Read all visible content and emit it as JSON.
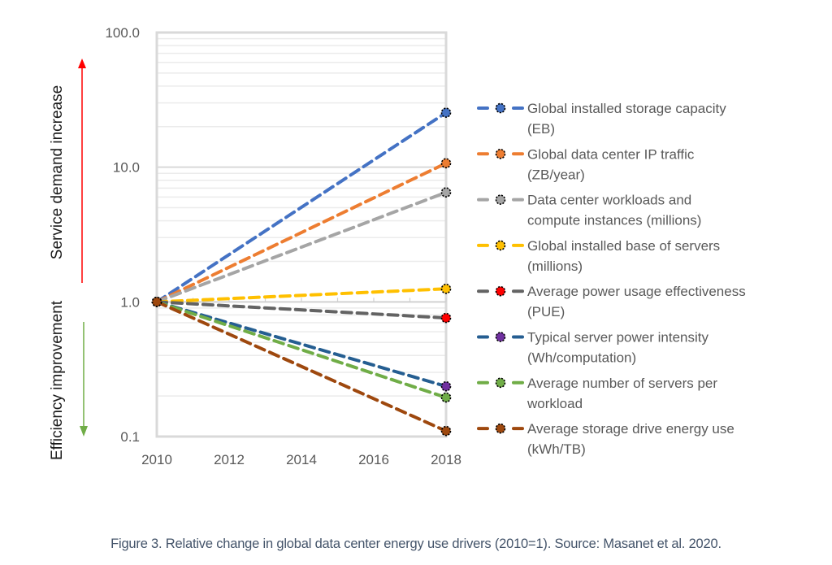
{
  "chart_data": {
    "type": "line",
    "title": "",
    "xlabel": "",
    "ylabel": "",
    "y_scale": "log",
    "ylim": [
      0.1,
      100
    ],
    "y_ticks": [
      "0.1",
      "1.0",
      "10.0",
      "100.0"
    ],
    "y_tick_values": [
      0.1,
      1,
      10,
      100
    ],
    "x_ticks": [
      "2010",
      "2012",
      "2014",
      "2016",
      "2018"
    ],
    "x_tick_values": [
      2010,
      2012,
      2014,
      2016,
      2018
    ],
    "xlim": [
      2010,
      2018
    ],
    "grid": "horizontal major and minor (log)",
    "legend_position": "right",
    "x": [
      2010,
      2018
    ],
    "series": [
      {
        "name": "Global installed storage capacity (EB)",
        "lines": [
          "Global installed storage capacity",
          "(EB)"
        ],
        "values": [
          1.0,
          25.4
        ],
        "line_color": "#4472C4",
        "marker_color": "#4472C4"
      },
      {
        "name": "Global data center IP traffic (ZB/year)",
        "lines": [
          "Global data center IP traffic",
          "(ZB/year)"
        ],
        "values": [
          1.0,
          10.7
        ],
        "line_color": "#ED7D31",
        "marker_color": "#ED7D31"
      },
      {
        "name": "Data center workloads and compute instances (millions)",
        "lines": [
          "Data center workloads and",
          "compute instances (millions)"
        ],
        "values": [
          1.0,
          6.5
        ],
        "line_color": "#A5A5A5",
        "marker_color": "#A5A5A5"
      },
      {
        "name": "Global installed base of servers (millions)",
        "lines": [
          "Global installed base of servers",
          "(millions)"
        ],
        "values": [
          1.0,
          1.25
        ],
        "line_color": "#FFC000",
        "marker_color": "#FFC000"
      },
      {
        "name": "Average power usage effectiveness (PUE)",
        "lines": [
          "Average power usage effectiveness",
          "(PUE)"
        ],
        "values": [
          1.0,
          0.76
        ],
        "line_color": "#636363",
        "marker_color": "#FF0000"
      },
      {
        "name": "Typical server power intensity (Wh/computation)",
        "lines": [
          "Typical server power intensity",
          "(Wh/computation)"
        ],
        "values": [
          1.0,
          0.236
        ],
        "line_color": "#255E91",
        "marker_color": "#7030A0"
      },
      {
        "name": "Average number of servers per workload",
        "lines": [
          "Average number of servers per",
          "workload"
        ],
        "values": [
          1.0,
          0.195
        ],
        "line_color": "#70AD47",
        "marker_color": "#70AD47"
      },
      {
        "name": "Average storage drive energy use (kWh/TB)",
        "lines": [
          "Average storage drive energy use",
          "(kWh/TB)"
        ],
        "values": [
          1.0,
          0.11
        ],
        "line_color": "#9E480E",
        "marker_color": "#9E480E"
      }
    ],
    "annotations": {
      "up_arrow_label": "Service demand increase",
      "up_arrow_color": "#FF0000",
      "down_arrow_label": "Efficiency improvement",
      "down_arrow_color": "#70AD47"
    }
  },
  "caption": "Figure 3. Relative change in global data center energy use drivers (2010=1). Source: Masanet et al. 2020."
}
